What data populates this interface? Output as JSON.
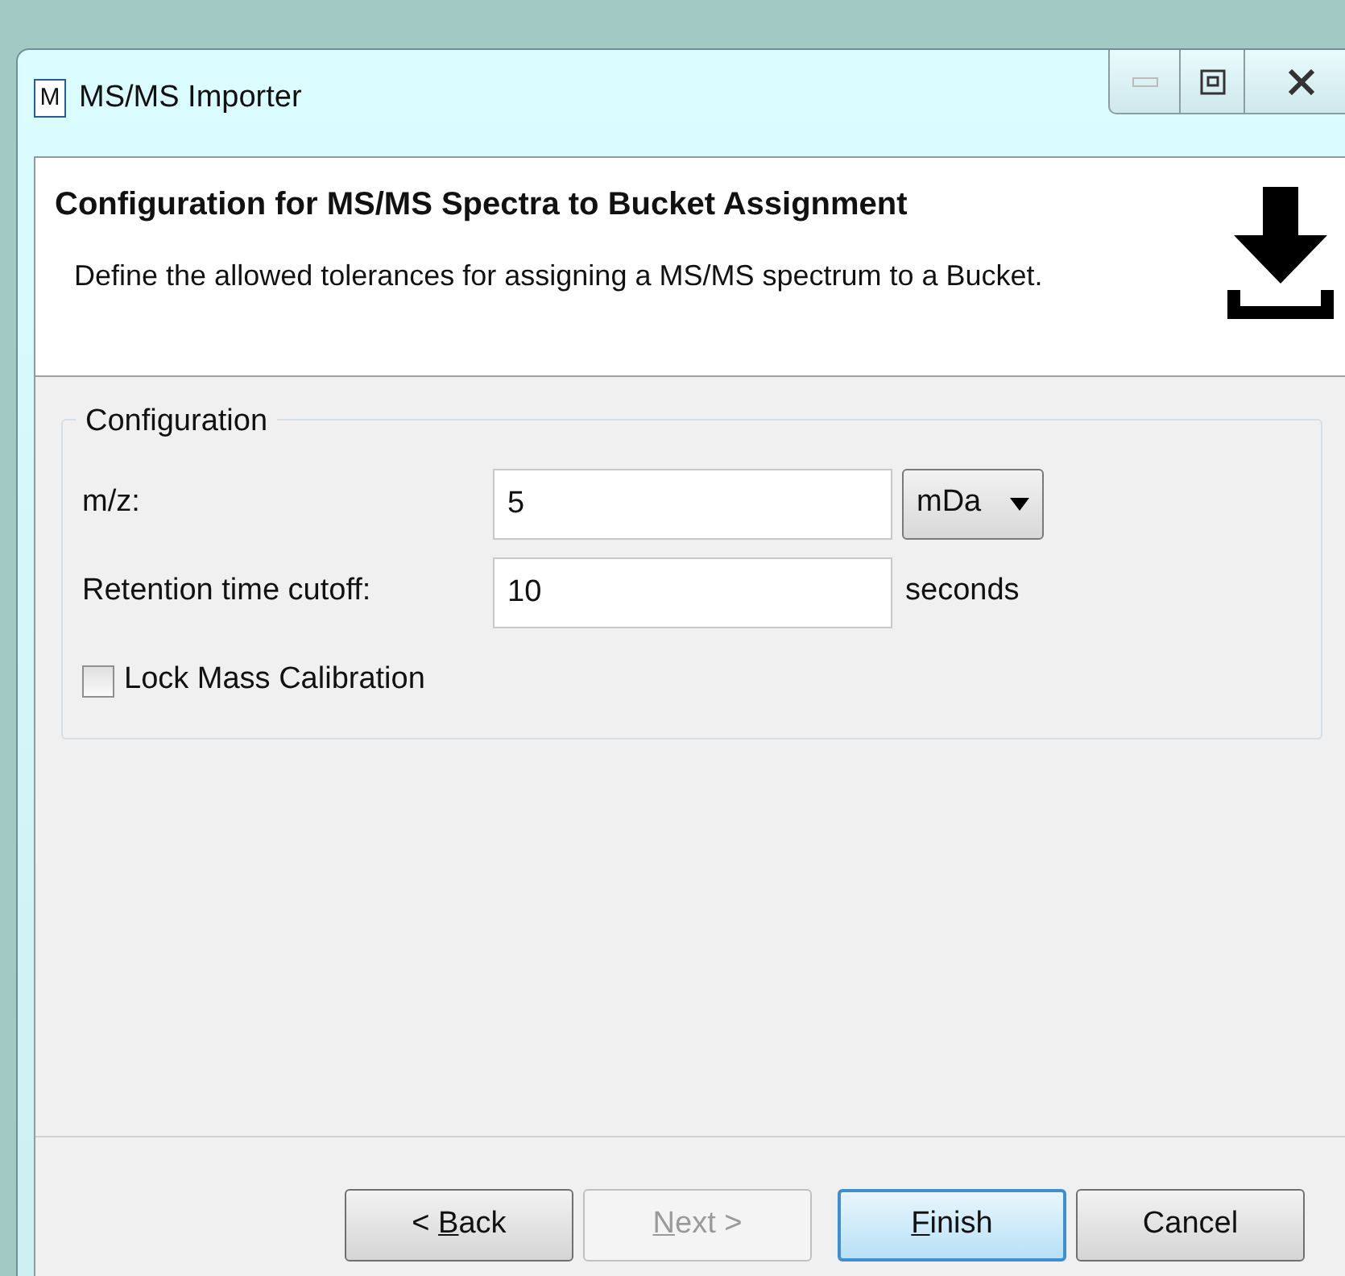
{
  "window": {
    "title": "MS/MS Importer",
    "app_icon": "M"
  },
  "header": {
    "title": "Configuration for MS/MS Spectra to Bucket Assignment",
    "description": "Define the allowed tolerances for assigning a MS/MS spectrum to a Bucket."
  },
  "group": {
    "title": "Configuration",
    "rows": [
      {
        "kind": "field",
        "label": "m/z:",
        "value": "5",
        "unit_dropdown": "mDa"
      },
      {
        "kind": "field",
        "label": "Retention time cutoff:",
        "value": "10",
        "unit": "seconds"
      },
      {
        "kind": "checkbox",
        "label": "Lock Mass Calibration",
        "checked": false
      }
    ]
  },
  "buttons": [
    {
      "before": "< ",
      "key": "B",
      "after": "ack",
      "disabled": false,
      "default": false
    },
    {
      "key": "N",
      "after": "ext >",
      "disabled": true,
      "default": false
    },
    {
      "key": "F",
      "after": "inish",
      "disabled": false,
      "default": true
    },
    {
      "before": "Cancel",
      "disabled": false,
      "default": false
    }
  ]
}
